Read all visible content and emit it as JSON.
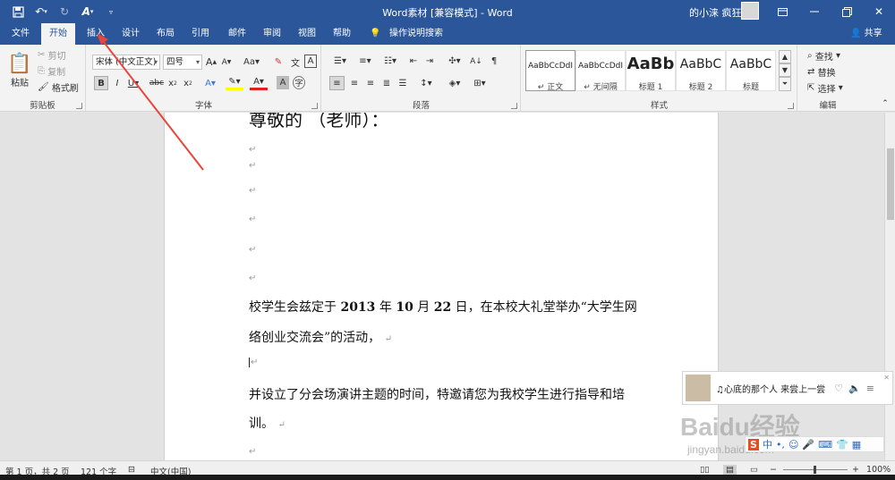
{
  "window": {
    "title": "Word素材 [兼容模式] - Word",
    "user": "的小涞 疯狂",
    "controls": [
      "ribbon-display-icon",
      "minimize-icon",
      "restore-icon",
      "close-icon"
    ]
  },
  "quick_access": [
    "save-icon",
    "undo-icon",
    "redo-icon",
    "format-painter-icon",
    "customize-icon"
  ],
  "tabs": [
    {
      "label": "文件",
      "active": false
    },
    {
      "label": "开始",
      "active": true
    },
    {
      "label": "插入",
      "active": false
    },
    {
      "label": "设计",
      "active": false
    },
    {
      "label": "布局",
      "active": false
    },
    {
      "label": "引用",
      "active": false
    },
    {
      "label": "邮件",
      "active": false
    },
    {
      "label": "审阅",
      "active": false
    },
    {
      "label": "视图",
      "active": false
    },
    {
      "label": "帮助",
      "active": false
    }
  ],
  "tell_me": "操作说明搜索",
  "share": "共享",
  "ribbon": {
    "clipboard": {
      "label": "剪贴板",
      "paste": "粘贴",
      "cut": "剪切",
      "copy": "复制",
      "format_painter": "格式刷"
    },
    "font": {
      "label": "字体",
      "font_name": "宋体 (中文正文)",
      "font_size": "四号"
    },
    "paragraph": {
      "label": "段落"
    },
    "styles": {
      "label": "样式",
      "items": [
        {
          "sample": "AaBbCcDdI",
          "name": "↵ 正文",
          "selected": true
        },
        {
          "sample": "AaBbCcDdI",
          "name": "↵ 无间隔",
          "selected": false
        },
        {
          "sample": "AaBb",
          "name": "标题 1",
          "selected": false
        },
        {
          "sample": "AaBbC",
          "name": "标题 2",
          "selected": false
        },
        {
          "sample": "AaBbC",
          "name": "标题",
          "selected": false
        }
      ]
    },
    "editing": {
      "label": "编辑",
      "find": "查找",
      "replace": "替换",
      "select": "选择"
    }
  },
  "document": {
    "heading_partial": "尊敬的          （老师）：",
    "line1_a": "校学生会兹定于 ",
    "line1_year": "2013",
    "line1_b": " 年 ",
    "line1_month": "10",
    "line1_c": " 月 ",
    "line1_day": "22",
    "line1_d": " 日，在本校大礼堂举办“大学生网",
    "line2": "络创业交流会”的活动，",
    "line3": "并设立了分会场演讲主题的时间，特邀请您为我校学生进行指导和培",
    "line4": "训。",
    "para_mark": "↵"
  },
  "music_popup": {
    "text": "♫心底的那个人 来尝上一尝"
  },
  "watermark": {
    "brand": "Baidu经验",
    "url": "jingyan.baidu.com"
  },
  "ime": {
    "label": "中"
  },
  "status": {
    "page": "第 1 页，共 2 页",
    "words": "121 个字",
    "language": "中文(中国)",
    "zoom": "100%"
  }
}
